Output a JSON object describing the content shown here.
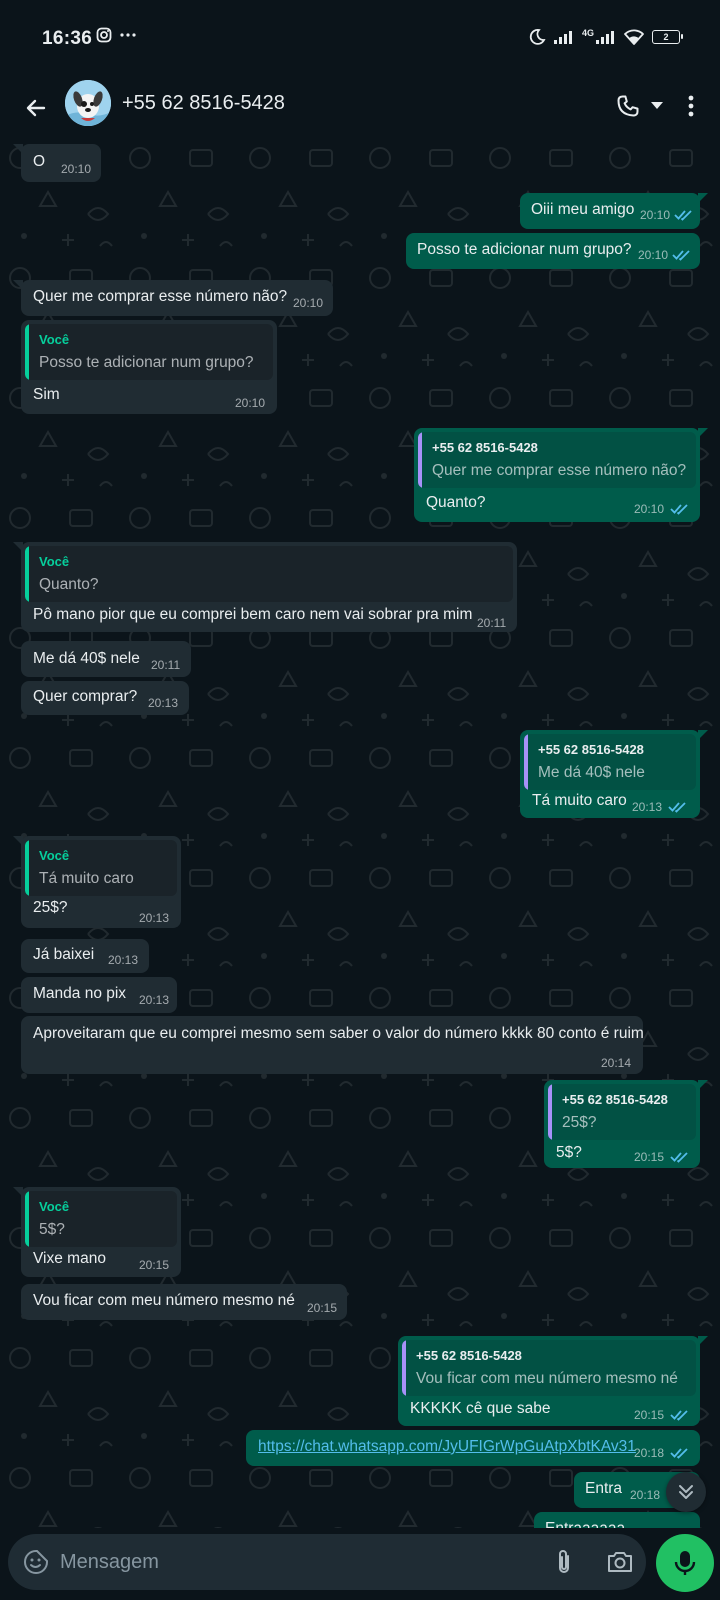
{
  "status": {
    "time": "16:36",
    "network": "4G",
    "battery": "2"
  },
  "header": {
    "contact_name": "+55 62 8516-5428"
  },
  "colors": {
    "accent_green": "#21c063",
    "outgoing_bubble": "#005c4b",
    "incoming_bubble": "#202c33",
    "quote_you": "#06cf9c",
    "quote_contact": "#a791f8",
    "tick_read": "#53bdeb"
  },
  "messages": [
    {
      "dir": "in",
      "text": "O",
      "time": "20:10"
    },
    {
      "dir": "out",
      "text": "Oiii meu amigo",
      "time": "20:10"
    },
    {
      "dir": "out",
      "text": "Posso te adicionar num grupo?",
      "time": "20:10"
    },
    {
      "dir": "in",
      "text": "Quer me comprar esse número não?",
      "time": "20:10"
    },
    {
      "dir": "in",
      "text": "Sim",
      "time": "20:10",
      "quote": {
        "author": "Você",
        "text": "Posso te adicionar num grupo?"
      }
    },
    {
      "dir": "out",
      "text": "Quanto?",
      "time": "20:10",
      "quote": {
        "author": "+55 62 8516-5428",
        "text": "Quer me comprar esse número não?"
      }
    },
    {
      "dir": "in",
      "text": "Pô mano pior que eu comprei bem caro nem vai sobrar pra mim",
      "time": "20:11",
      "quote": {
        "author": "Você",
        "text": "Quanto?"
      }
    },
    {
      "dir": "in",
      "text": "Me dá 40$ nele",
      "time": "20:11"
    },
    {
      "dir": "in",
      "text": "Quer comprar?",
      "time": "20:13"
    },
    {
      "dir": "out",
      "text": "Tá muito caro",
      "time": "20:13",
      "quote": {
        "author": "+55 62 8516-5428",
        "text": "Me dá 40$ nele"
      }
    },
    {
      "dir": "in",
      "text": "25$?",
      "time": "20:13",
      "quote": {
        "author": "Você",
        "text": "Tá muito caro"
      }
    },
    {
      "dir": "in",
      "text": "Já baixei",
      "time": "20:13"
    },
    {
      "dir": "in",
      "text": "Manda no pix",
      "time": "20:13"
    },
    {
      "dir": "in",
      "text": "Aproveitaram que eu comprei mesmo sem saber o valor do número kkkk 80 conto é ruim",
      "time": "20:14"
    },
    {
      "dir": "out",
      "text": "5$?",
      "time": "20:15",
      "quote": {
        "author": "+55 62 8516-5428",
        "text": "25$?"
      }
    },
    {
      "dir": "in",
      "text": "Vixe mano",
      "time": "20:15",
      "quote": {
        "author": "Você",
        "text": "5$?"
      }
    },
    {
      "dir": "in",
      "text": "Vou ficar com meu número mesmo né",
      "time": "20:15"
    },
    {
      "dir": "out",
      "text": "KKKKK cê que sabe",
      "time": "20:15",
      "quote": {
        "author": "+55 62 8516-5428",
        "text": "Vou ficar com meu número mesmo né"
      }
    },
    {
      "dir": "out",
      "text": "https://chat.whatsapp.com/JyUFIGrWpGuAtpXbtKAv31",
      "time": "20:18",
      "link": true
    },
    {
      "dir": "out",
      "text": "Entra",
      "time": "20:18"
    },
    {
      "dir": "out",
      "text": "Entraaaaaa",
      "time": ""
    }
  ],
  "composer": {
    "placeholder": "Mensagem"
  }
}
